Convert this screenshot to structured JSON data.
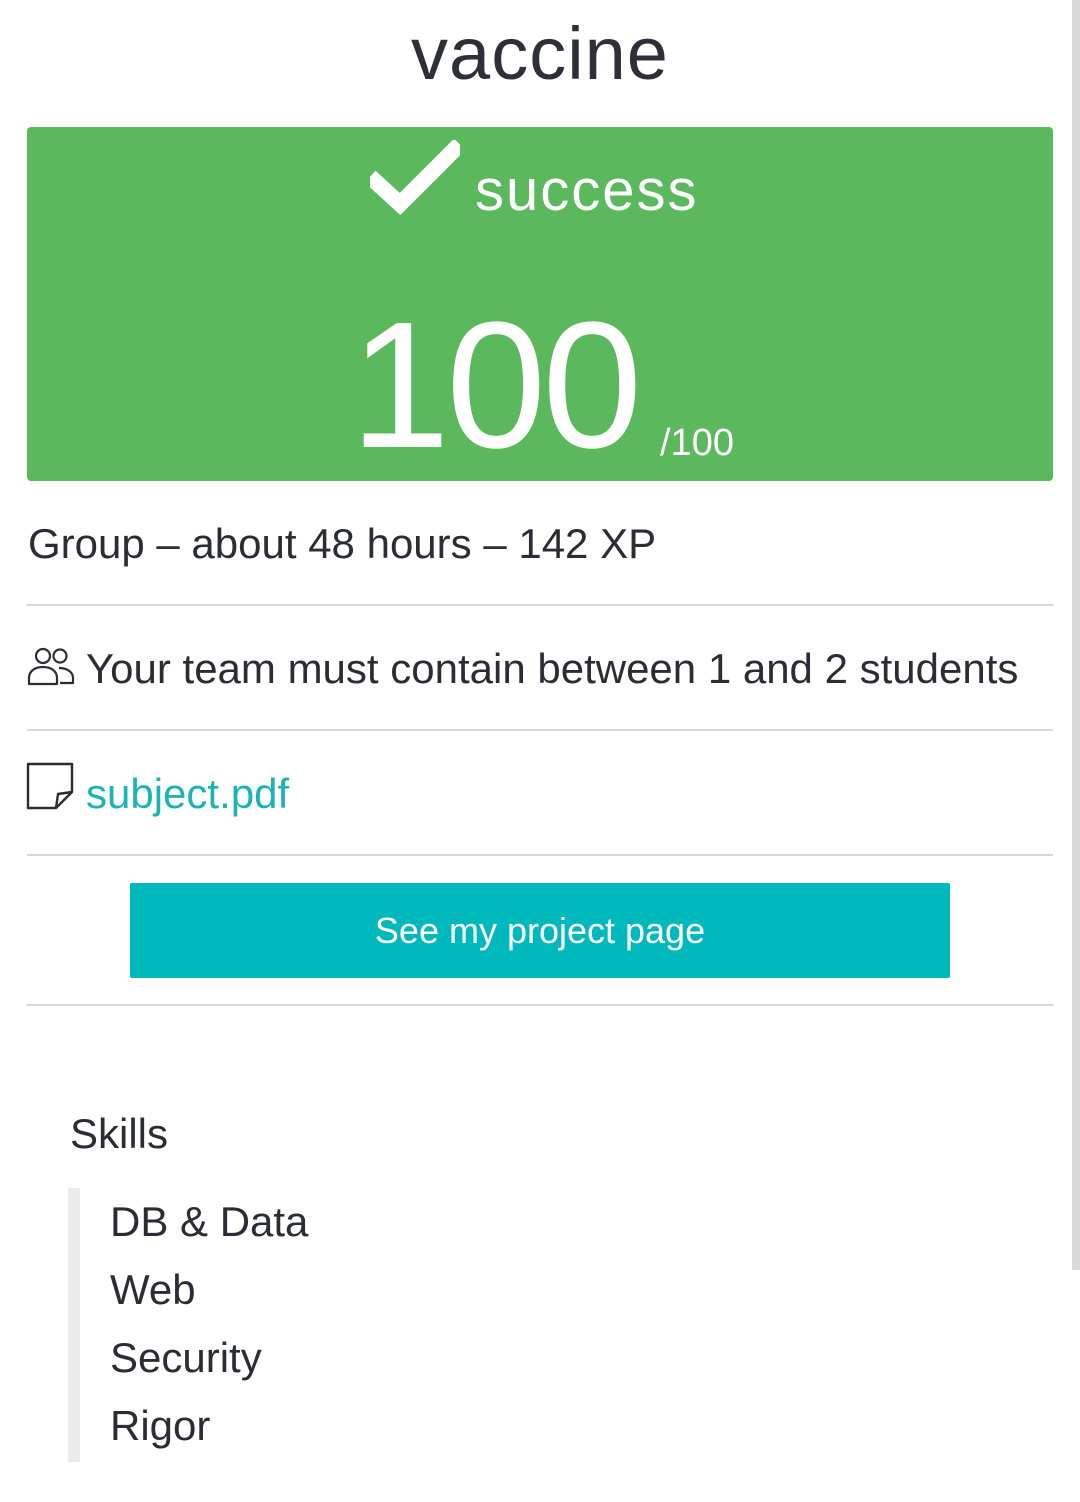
{
  "project": {
    "title": "vaccine"
  },
  "result": {
    "status_icon": "checkmark-icon",
    "status_label": "success",
    "score": "100",
    "score_max": "/100",
    "color": "#5cb85c"
  },
  "meta": {
    "text": "Group – about 48 hours – 142 XP"
  },
  "team": {
    "icon": "users-icon",
    "text": "Your team must contain between 1 and 2 students"
  },
  "attachment": {
    "icon": "document-icon",
    "label": "subject.pdf",
    "color": "#1bb3b3"
  },
  "actions": {
    "project_page_label": "See my project page",
    "button_color": "#00b9bc"
  },
  "skills": {
    "title": "Skills",
    "items": [
      {
        "label": "DB & Data"
      },
      {
        "label": "Web"
      },
      {
        "label": "Security"
      },
      {
        "label": "Rigor"
      }
    ]
  }
}
